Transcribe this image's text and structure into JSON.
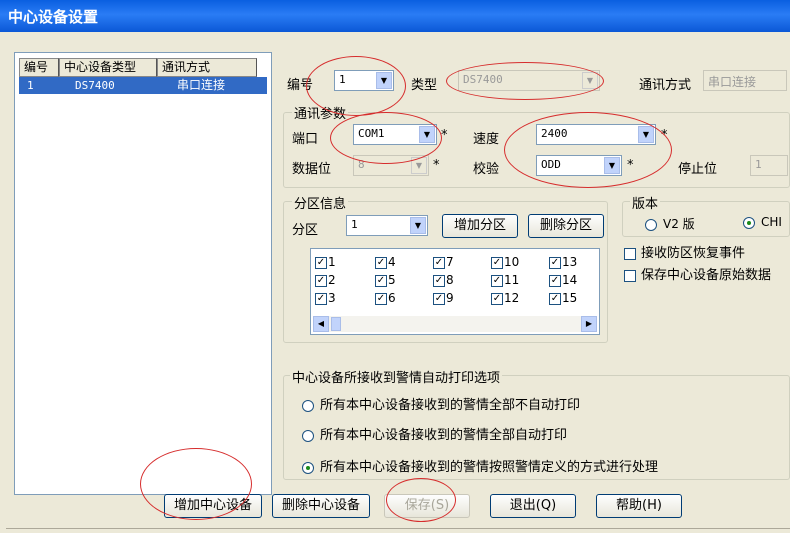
{
  "window": {
    "title": "中心设备设置"
  },
  "device_list": {
    "columns": [
      "编号",
      "中心设备类型",
      "通讯方式"
    ],
    "rows": [
      {
        "id": "1",
        "type": "DS7400",
        "comm": "串口连接"
      }
    ]
  },
  "top": {
    "number_label": "编号",
    "number_value": "1",
    "type_label": "类型",
    "type_value": "DS7400",
    "comm_label": "通讯方式",
    "comm_value": "串口连接"
  },
  "comm_params": {
    "title": "通讯参数",
    "port_label": "端口",
    "port_value": "COM1",
    "speed_label": "速度",
    "speed_value": "2400",
    "databits_label": "数据位",
    "databits_value": "8",
    "parity_label": "校验",
    "parity_value": "ODD",
    "stopbits_label": "停止位",
    "stopbits_value": "1",
    "required_mark": "*"
  },
  "partition": {
    "title": "分区信息",
    "zone_label": "分区",
    "zone_value": "1",
    "add_button": "增加分区",
    "delete_button": "删除分区",
    "checkboxes": [
      "1",
      "2",
      "3",
      "4",
      "5",
      "6",
      "7",
      "8",
      "9",
      "10",
      "11",
      "12",
      "13",
      "14",
      "15"
    ]
  },
  "version": {
    "title": "版本",
    "v2_label": "V2 版",
    "chi_label": "CHI",
    "receive_restore_label": "接收防区恢复事件",
    "save_raw_label": "保存中心设备原始数据"
  },
  "auto_print": {
    "title": "中心设备所接收到警情自动打印选项",
    "options": [
      "所有本中心设备接收到的警情全部不自动打印",
      "所有本中心设备接收到的警情全部自动打印",
      "所有本中心设备接收到的警情按照警情定义的方式进行处理"
    ],
    "selected_index": 2
  },
  "buttons": {
    "add_device": "增加中心设备",
    "delete_device": "删除中心设备",
    "save": "保存(S)",
    "exit": "退出(Q)",
    "help": "帮助(H)"
  },
  "colors": {
    "title_bar": "#0a5fe0",
    "selection": "#316ac5",
    "annotation": "#d62d2d"
  }
}
